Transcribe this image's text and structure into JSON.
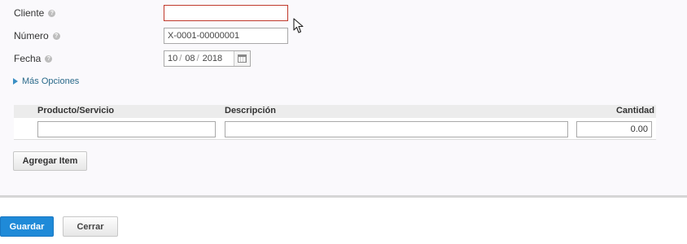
{
  "form": {
    "cliente": {
      "label": "Cliente",
      "value": ""
    },
    "numero": {
      "label": "Número",
      "value": "X-0001-00000001"
    },
    "fecha": {
      "label": "Fecha",
      "day": "10",
      "month": "08",
      "year": "2018",
      "separator": "/"
    },
    "more_options": "Más Opciones"
  },
  "items_table": {
    "headers": {
      "producto": "Producto/Servicio",
      "descripcion": "Descripción",
      "cantidad": "Cantidad"
    },
    "row": {
      "producto": "",
      "descripcion": "",
      "cantidad": "0.00"
    },
    "add_item_label": "Agregar Item"
  },
  "footer": {
    "save_label": "Guardar",
    "close_label": "Cerrar"
  },
  "icons": {
    "help": "question-circle-icon",
    "calendar": "calendar-icon",
    "expand": "triangle-right-icon",
    "cursor": "mouse-pointer-icon"
  },
  "colors": {
    "primary": "#1f8ad8",
    "error_border": "#c0392b",
    "link": "#2a6a8a"
  }
}
